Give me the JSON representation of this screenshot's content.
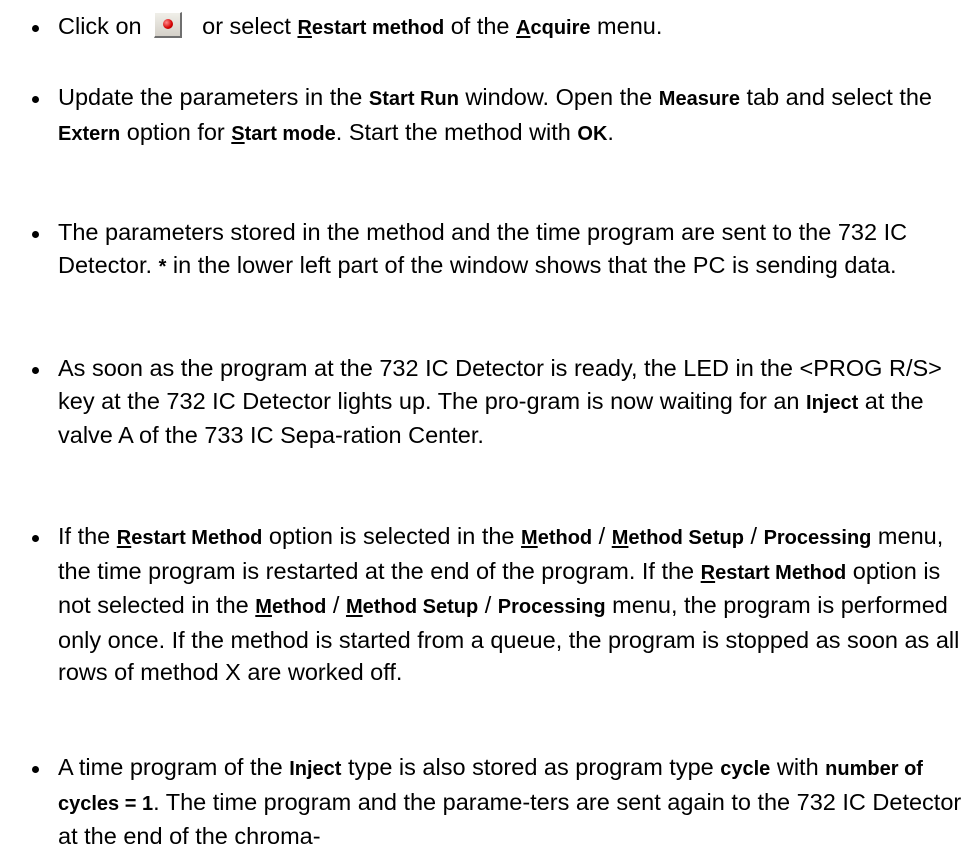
{
  "items": [
    {
      "segments": [
        {
          "t": "Click on"
        },
        {
          "icon": "restart-method-button"
        },
        {
          "t": " or select "
        },
        {
          "t": "R",
          "b": true,
          "u": true
        },
        {
          "t": "estart method",
          "b": true
        },
        {
          "t": " of the "
        },
        {
          "t": "A",
          "b": true,
          "u": true
        },
        {
          "t": "cquire",
          "b": true
        },
        {
          "t": " menu."
        }
      ]
    },
    {
      "segments": [
        {
          "t": "Update the parameters in the "
        },
        {
          "t": "Start Run",
          "b": true
        },
        {
          "t": " window. Open the "
        },
        {
          "t": "Measure",
          "b": true
        },
        {
          "t": " tab and select the "
        },
        {
          "t": "Extern",
          "b": true
        },
        {
          "t": " option for "
        },
        {
          "t": "S",
          "b": true,
          "u": true
        },
        {
          "t": "tart mode",
          "b": true
        },
        {
          "t": ". Start the method with "
        },
        {
          "t": "OK",
          "b": true
        },
        {
          "t": "."
        }
      ]
    },
    {
      "segments": [
        {
          "t": "The parameters stored in the method and the time program are sent to the 732 IC Detector. "
        },
        {
          "t": "*",
          "b": true
        },
        {
          "t": "  in the lower left part of the window shows that the PC is sending data."
        }
      ]
    },
    {
      "segments": [
        {
          "t": "As soon as the program at the 732 IC Detector is ready, the LED in the <PROG R/S> key at the 732 IC Detector lights up. The pro-gram is now waiting for an "
        },
        {
          "t": "Inject",
          "b": true
        },
        {
          "t": " at the valve A of the 733 IC Sepa-ration Center."
        }
      ]
    },
    {
      "segments": [
        {
          "t": "If the "
        },
        {
          "t": "R",
          "b": true,
          "u": true
        },
        {
          "t": "estart Method",
          "b": true
        },
        {
          "t": " option is selected in the "
        },
        {
          "t": "M",
          "b": true,
          "u": true
        },
        {
          "t": "ethod",
          "b": true
        },
        {
          "t": " / "
        },
        {
          "t": "M",
          "b": true,
          "u": true
        },
        {
          "t": "ethod Setup",
          "b": true
        },
        {
          "t": " / "
        },
        {
          "t": "Processing",
          "b": true
        },
        {
          "t": " menu, the time program is restarted at the end of the program. If the "
        },
        {
          "t": "R",
          "b": true,
          "u": true
        },
        {
          "t": "estart Method",
          "b": true
        },
        {
          "t": " option is not selected in the "
        },
        {
          "t": "M",
          "b": true,
          "u": true
        },
        {
          "t": "ethod",
          "b": true
        },
        {
          "t": " / "
        },
        {
          "t": "M",
          "b": true,
          "u": true
        },
        {
          "t": "ethod Setup",
          "b": true
        },
        {
          "t": " / "
        },
        {
          "t": "Processing",
          "b": true
        },
        {
          "t": " menu, the program is performed only once. If the method is started from a queue, the program is stopped as soon as all rows of method X are worked off."
        }
      ]
    },
    {
      "segments": [
        {
          "t": "A time program of the "
        },
        {
          "t": "Inject",
          "b": true
        },
        {
          "t": " type is also stored as program type "
        },
        {
          "t": "cycle",
          "b": true
        },
        {
          "t": " with "
        },
        {
          "t": "number of cycles = 1",
          "b": true
        },
        {
          "t": ". The time program and the parame-ters are sent again to the 732 IC Detector at the end of the chroma-"
        }
      ]
    }
  ]
}
